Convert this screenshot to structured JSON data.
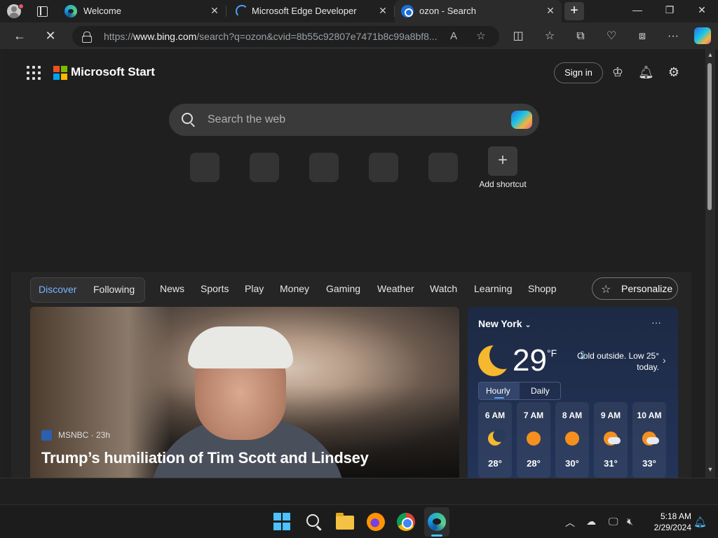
{
  "browser": {
    "tabs": [
      {
        "title": "Welcome",
        "icon": "edge-icon",
        "active": false
      },
      {
        "title": "Microsoft Edge Developer",
        "icon": "loading-spinner-icon",
        "active": false
      },
      {
        "title": "ozon - Search",
        "icon": "bing-icon",
        "active": true
      }
    ],
    "close_glyph": "✕",
    "new_tab_glyph": "+",
    "url_prefix": "https://",
    "url_host": "www.bing.com",
    "url_rest": "/search?q=ozon&cvid=8b55c92807e7471b8c99a8bf8..."
  },
  "page": {
    "brand": "Microsoft Start",
    "sign_in": "Sign in",
    "search_placeholder": "Search the web",
    "add_shortcut": "Add shortcut",
    "pills": [
      "Discover",
      "Following"
    ],
    "nav": [
      "News",
      "Sports",
      "Play",
      "Money",
      "Gaming",
      "Weather",
      "Watch",
      "Learning",
      "Shopp"
    ],
    "personalize": "Personalize",
    "hero": {
      "source": "MSNBC · 23h",
      "headline": "Trump’s humiliation of Tim Scott and Lindsey"
    },
    "weather": {
      "city": "New York",
      "temp": "29",
      "unit": "°F",
      "note": "Cold outside. Low 25° today.",
      "tabs": [
        "Hourly",
        "Daily"
      ],
      "hours": [
        {
          "time": "6 AM",
          "icon": "moon-icon",
          "temp": "28°"
        },
        {
          "time": "7 AM",
          "icon": "sun-icon",
          "temp": "28°"
        },
        {
          "time": "8 AM",
          "icon": "sun-icon",
          "temp": "30°"
        },
        {
          "time": "9 AM",
          "icon": "partly-cloudy-icon",
          "temp": "31°"
        },
        {
          "time": "10 AM",
          "icon": "partly-cloudy-icon",
          "temp": "33°"
        }
      ]
    }
  },
  "colors": {
    "accent": "#4cc2ff",
    "discover_active": "#7ab4ff",
    "ms_red": "#f25022",
    "ms_green": "#7fba00",
    "ms_blue": "#00a4ef",
    "ms_yellow": "#ffb900"
  },
  "taskbar": {
    "time": "5:18 AM",
    "date": "2/29/2024"
  }
}
